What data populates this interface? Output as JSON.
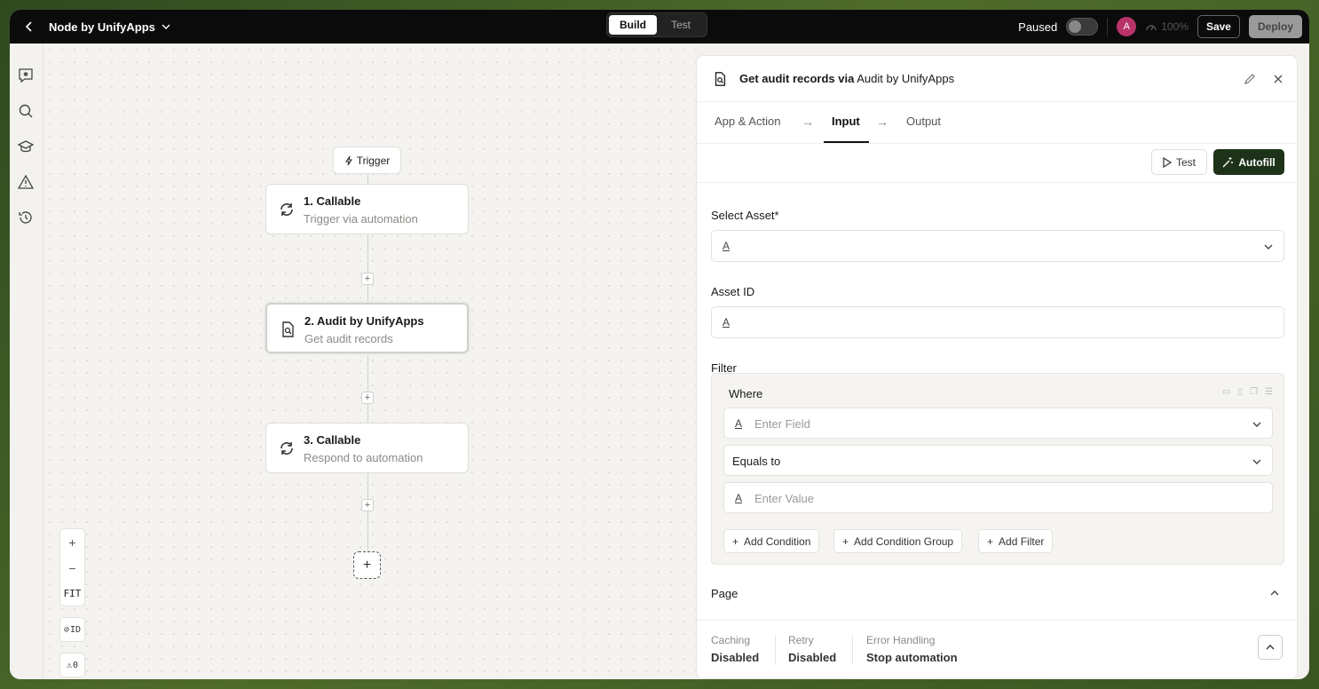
{
  "topbar": {
    "app_title": "Node by UnifyApps",
    "modes": [
      "Build",
      "Test"
    ],
    "active_mode": "Build",
    "status_label": "Paused",
    "avatar_initial": "A",
    "zoom": "100%",
    "save_label": "Save",
    "deploy_label": "Deploy"
  },
  "sidebar": {
    "icons": [
      "ai-chat-icon",
      "search-icon",
      "graduation-cap-icon",
      "warning-icon",
      "history-icon"
    ]
  },
  "canvas": {
    "trigger_label": "Trigger",
    "nodes": [
      {
        "title": "1. Callable",
        "subtitle": "Trigger via automation",
        "icon": "refresh-icon"
      },
      {
        "title": "2. Audit by UnifyApps",
        "subtitle": "Get audit records",
        "icon": "audit-doc-icon",
        "selected": true
      },
      {
        "title": "3. Callable",
        "subtitle": "Respond to automation",
        "icon": "refresh-icon"
      }
    ],
    "zoom_controls": {
      "zoom_in": "+",
      "zoom_out": "−",
      "fit": "FIT",
      "id_toggle": "ID",
      "warnings_count": "0"
    }
  },
  "panel": {
    "title_prefix": "Get audit records via",
    "title_app": "Audit by UnifyApps",
    "tabs": [
      "App & Action",
      "Input",
      "Output"
    ],
    "active_tab": "Input",
    "test_label": "Test",
    "autofill_label": "Autofill",
    "select_asset_label": "Select Asset*",
    "asset_id_label": "Asset ID",
    "filter_label": "Filter",
    "where_label": "Where",
    "field_placeholder": "Enter Field",
    "operator_value": "Equals to",
    "value_placeholder": "Enter Value",
    "add_buttons": [
      "Add Condition",
      "Add Condition Group",
      "Add Filter"
    ],
    "page_label": "Page",
    "type_glyph": "A",
    "footer": [
      {
        "key": "Caching",
        "value": "Disabled"
      },
      {
        "key": "Retry",
        "value": "Disabled"
      },
      {
        "key": "Error Handling",
        "value": "Stop automation"
      }
    ]
  },
  "colors": {
    "topbar_bg": "#0b0b0b",
    "autofill_bg": "#1d3219",
    "avatar_bg": "#b8336a"
  }
}
